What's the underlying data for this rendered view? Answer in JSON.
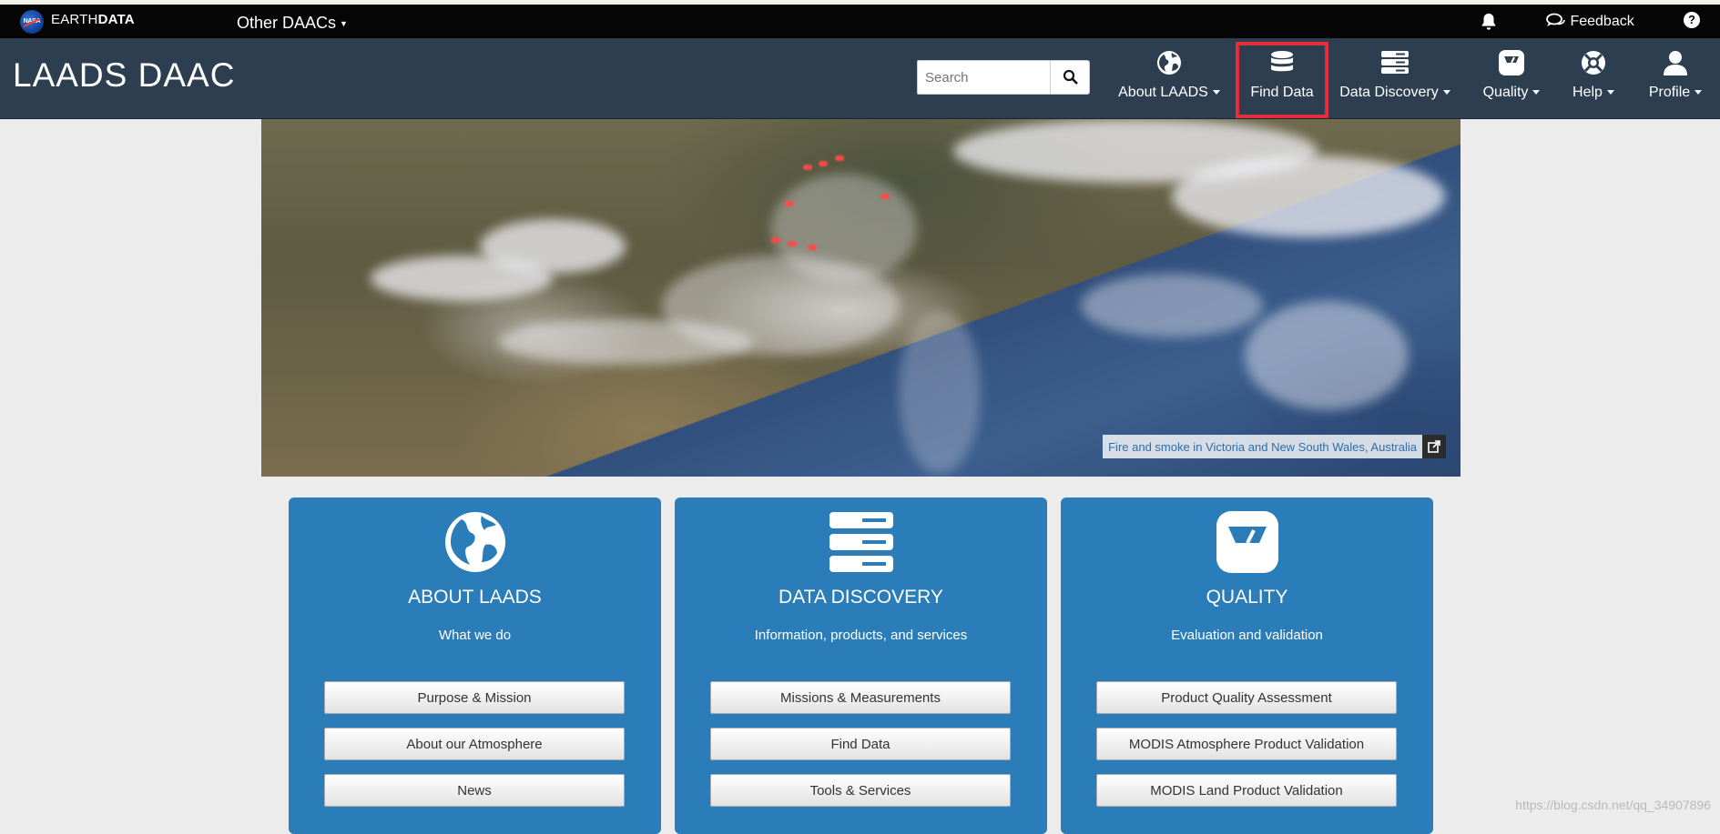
{
  "earthdata_bar": {
    "logo_text": "NASA",
    "brand_light": "EARTH",
    "brand_bold": "DATA",
    "other_daacs": "Other DAACs",
    "feedback": "Feedback",
    "help": "?"
  },
  "header": {
    "title": "LAADS DAAC",
    "search_placeholder": "Search",
    "nav": [
      {
        "label": "About LAADS",
        "icon": "globe-icon",
        "has_dropdown": true
      },
      {
        "label": "Find Data",
        "icon": "database-icon",
        "has_dropdown": false,
        "highlighted": true
      },
      {
        "label": "Data Discovery",
        "icon": "server-icon",
        "has_dropdown": true
      },
      {
        "label": "Quality",
        "icon": "scale-icon",
        "has_dropdown": true
      },
      {
        "label": "Help",
        "icon": "lifebuoy-icon",
        "has_dropdown": true
      },
      {
        "label": "Profile",
        "icon": "user-icon",
        "has_dropdown": true
      }
    ]
  },
  "hero": {
    "caption": "Fire and smoke in Victoria and New South Wales, Australia"
  },
  "cards": [
    {
      "title": "ABOUT LAADS",
      "subtitle": "What we do",
      "icon": "globe-icon",
      "buttons": [
        "Purpose & Mission",
        "About our Atmosphere",
        "News"
      ]
    },
    {
      "title": "DATA DISCOVERY",
      "subtitle": "Information, products, and services",
      "icon": "server-icon",
      "buttons": [
        "Missions & Measurements",
        "Find Data",
        "Tools & Services"
      ]
    },
    {
      "title": "QUALITY",
      "subtitle": "Evaluation and validation",
      "icon": "scale-icon",
      "buttons": [
        "Product Quality Assessment",
        "MODIS Atmosphere Product Validation",
        "MODIS Land Product Validation"
      ]
    }
  ],
  "watermark": "https://blog.csdn.net/qq_34907896",
  "colors": {
    "earthdata_bar": "#050505",
    "header": "#2c3e50",
    "card": "#2a7db8",
    "highlight": "#e62e3b"
  }
}
